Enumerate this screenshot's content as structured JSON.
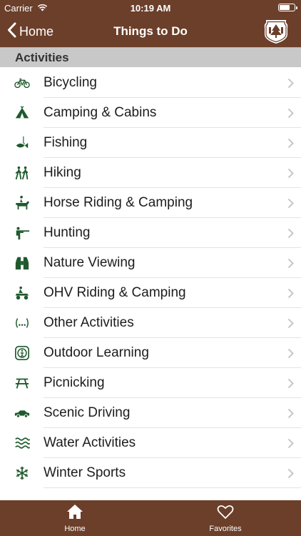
{
  "status_bar": {
    "carrier": "Carrier",
    "time": "10:19 AM",
    "battery_level": 0.7
  },
  "nav": {
    "back_label": "Home",
    "title": "Things to Do",
    "logo_icon": "usfs-shield-icon"
  },
  "section": {
    "title": "Activities"
  },
  "activities": [
    {
      "label": "Bicycling",
      "icon": "bicycle-icon"
    },
    {
      "label": "Camping & Cabins",
      "icon": "tent-icon"
    },
    {
      "label": "Fishing",
      "icon": "fish-icon"
    },
    {
      "label": "Hiking",
      "icon": "hikers-icon"
    },
    {
      "label": "Horse Riding & Camping",
      "icon": "horse-rider-icon"
    },
    {
      "label": "Hunting",
      "icon": "hunter-icon"
    },
    {
      "label": "Nature Viewing",
      "icon": "binoculars-icon"
    },
    {
      "label": "OHV Riding & Camping",
      "icon": "atv-icon"
    },
    {
      "label": "Other Activities",
      "icon": "ellipsis-icon"
    },
    {
      "label": "Outdoor Learning",
      "icon": "interpretive-icon"
    },
    {
      "label": "Picnicking",
      "icon": "picnic-table-icon"
    },
    {
      "label": "Scenic Driving",
      "icon": "car-icon"
    },
    {
      "label": "Water Activities",
      "icon": "water-waves-icon"
    },
    {
      "label": "Winter Sports",
      "icon": "snowflake-icon"
    }
  ],
  "tabs": [
    {
      "label": "Home",
      "icon": "home-icon"
    },
    {
      "label": "Favorites",
      "icon": "heart-icon"
    }
  ],
  "colors": {
    "brand": "#6b3f2a",
    "icon_green": "#1f5a2e",
    "section_bg": "#c8c8c8",
    "chevron": "#c7c7cc"
  }
}
